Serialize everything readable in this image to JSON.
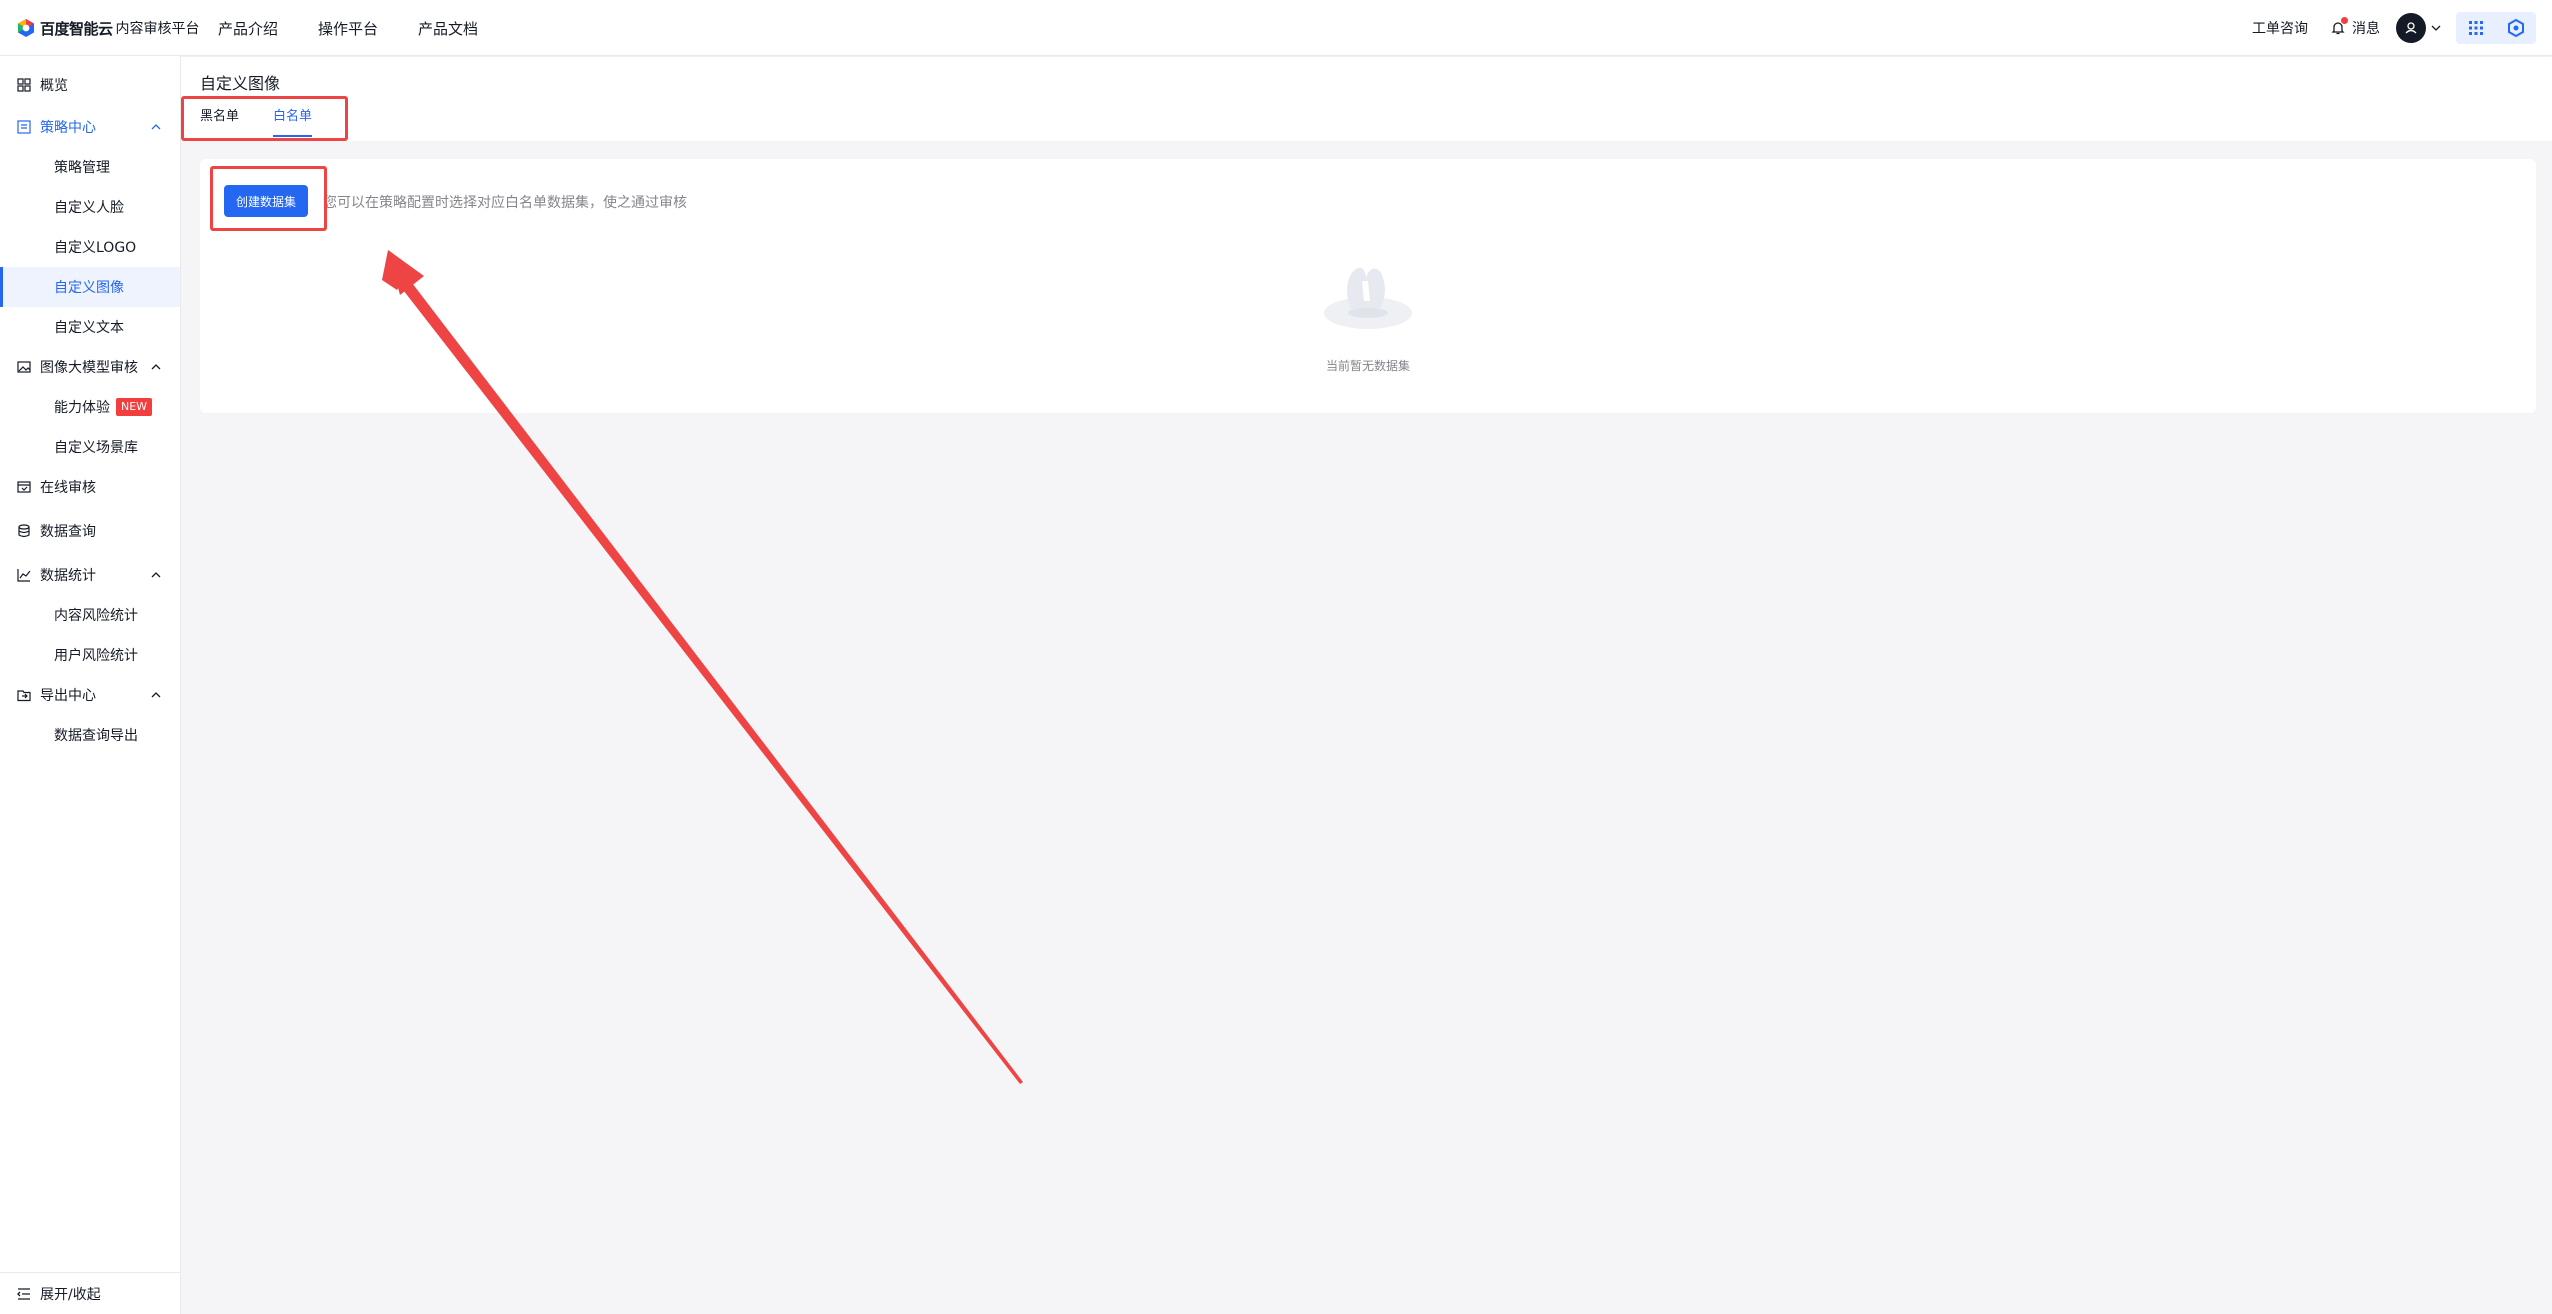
{
  "header": {
    "brand": "百度智能云",
    "product": "内容审核平台",
    "nav": [
      "产品介绍",
      "操作平台",
      "产品文档"
    ],
    "ticket": "工单咨询",
    "messages": "消息"
  },
  "sidebar": {
    "items": [
      {
        "label": "概览",
        "icon": "grid-icon"
      },
      {
        "label": "策略中心",
        "icon": "policy-icon"
      },
      {
        "label": "策略管理"
      },
      {
        "label": "自定义人脸"
      },
      {
        "label": "自定义LOGO"
      },
      {
        "label": "自定义图像"
      },
      {
        "label": "自定义文本"
      },
      {
        "label": "图像大模型审核",
        "icon": "image-icon"
      },
      {
        "label": "能力体验",
        "badge": "NEW"
      },
      {
        "label": "自定义场景库"
      },
      {
        "label": "在线审核",
        "icon": "review-icon"
      },
      {
        "label": "数据查询",
        "icon": "database-icon"
      },
      {
        "label": "数据统计",
        "icon": "chart-icon"
      },
      {
        "label": "内容风险统计"
      },
      {
        "label": "用户风险统计"
      },
      {
        "label": "导出中心",
        "icon": "export-icon"
      },
      {
        "label": "数据查询导出"
      }
    ],
    "footer": "展开/收起"
  },
  "page": {
    "title": "自定义图像",
    "tabs": [
      "黑名单",
      "白名单"
    ],
    "active_tab": "白名单",
    "create_button": "创建数据集",
    "hint": "您可以在策略配置时选择对应白名单数据集，使之通过审核",
    "empty_text": "当前暂无数据集"
  },
  "colors": {
    "primary": "#2468f2",
    "annotation": "#ef4444",
    "badge": "#f33e3e"
  }
}
